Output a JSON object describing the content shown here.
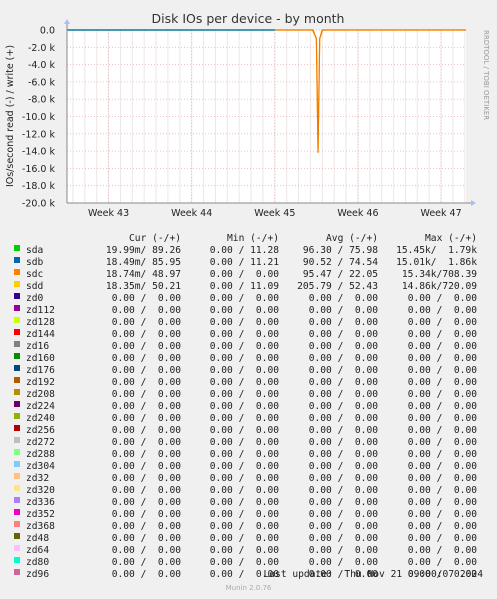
{
  "chart_data": {
    "type": "line",
    "title": "Disk IOs per device - by month",
    "ylabel": "IOs/second read (-) / write (+)",
    "ylim": [
      -20000,
      0
    ],
    "yticks": [
      0,
      -2000,
      -4000,
      -6000,
      -8000,
      -10000,
      -12000,
      -14000,
      -16000,
      -18000,
      -20000
    ],
    "ytick_labels": [
      "0.0",
      "-2.0 k",
      "-4.0 k",
      "-6.0 k",
      "-8.0 k",
      "-10.0 k",
      "-12.0 k",
      "-14.0 k",
      "-16.0 k",
      "-18.0 k",
      "-20.0 k"
    ],
    "xticks": [
      "Week 43",
      "Week 44",
      "Week 45",
      "Week 46",
      "Week 47"
    ],
    "xtick_positions": [
      43,
      44,
      45,
      46,
      47
    ],
    "xlim": [
      42.5,
      47.3
    ],
    "grid": true,
    "legend_position": "bottom",
    "series": [
      {
        "name": "sdd",
        "color": "#f6c200",
        "x": [
          45.0,
          45.45,
          45.5,
          45.52,
          45.54,
          45.58,
          47.3
        ],
        "y": [
          0,
          0,
          -1000,
          -13800,
          -1000,
          0,
          0
        ]
      },
      {
        "name": "sdc",
        "color": "#f57900",
        "x": [
          45.0,
          45.46,
          45.5,
          45.52,
          45.54,
          45.57,
          47.3
        ],
        "y": [
          0,
          0,
          -1000,
          -14200,
          -1000,
          0,
          0
        ]
      },
      {
        "name": "sda",
        "color": "#00cc00",
        "x": [
          42.5,
          45.0
        ],
        "y": [
          0,
          0
        ]
      },
      {
        "name": "sdb",
        "color": "#0066b3",
        "x": [
          42.5,
          45.0
        ],
        "y": [
          0,
          0
        ]
      }
    ]
  },
  "side_credit": "RRDTOOL / TOBI OETIKER",
  "legend": {
    "headers": {
      "cur": "Cur (-/+)",
      "min": "Min (-/+)",
      "avg": "Avg (-/+)",
      "max": "Max (-/+)"
    },
    "rows": [
      {
        "name": "sda",
        "color": "#00cc00",
        "cur": "19.99m/ 89.26",
        "min": "0.00 / 11.28",
        "avg": "96.30 / 75.98",
        "max": "15.45k/  1.79k"
      },
      {
        "name": "sdb",
        "color": "#0066b3",
        "cur": "18.49m/ 85.95",
        "min": "0.00 / 11.21",
        "avg": "90.52 / 74.54",
        "max": "15.01k/  1.86k"
      },
      {
        "name": "sdc",
        "color": "#ff8000",
        "cur": "18.74m/ 48.97",
        "min": "0.00 /  0.00",
        "avg": "95.47 / 22.05",
        "max": "15.34k/708.39"
      },
      {
        "name": "sdd",
        "color": "#ffcc00",
        "cur": "18.35m/ 50.21",
        "min": "0.00 / 11.09",
        "avg": "205.79 / 52.43",
        "max": "14.86k/720.09"
      },
      {
        "name": "zd0",
        "color": "#330099",
        "cur": "0.00 /  0.00",
        "min": "0.00 /  0.00",
        "avg": "0.00 /  0.00",
        "max": "0.00 /  0.00"
      },
      {
        "name": "zd112",
        "color": "#990099",
        "cur": "0.00 /  0.00",
        "min": "0.00 /  0.00",
        "avg": "0.00 /  0.00",
        "max": "0.00 /  0.00"
      },
      {
        "name": "zd128",
        "color": "#ccff00",
        "cur": "0.00 /  0.00",
        "min": "0.00 /  0.00",
        "avg": "0.00 /  0.00",
        "max": "0.00 /  0.00"
      },
      {
        "name": "zd144",
        "color": "#ff0000",
        "cur": "0.00 /  0.00",
        "min": "0.00 /  0.00",
        "avg": "0.00 /  0.00",
        "max": "0.00 /  0.00"
      },
      {
        "name": "zd16",
        "color": "#808080",
        "cur": "0.00 /  0.00",
        "min": "0.00 /  0.00",
        "avg": "0.00 /  0.00",
        "max": "0.00 /  0.00"
      },
      {
        "name": "zd160",
        "color": "#008f00",
        "cur": "0.00 /  0.00",
        "min": "0.00 /  0.00",
        "avg": "0.00 /  0.00",
        "max": "0.00 /  0.00"
      },
      {
        "name": "zd176",
        "color": "#00487d",
        "cur": "0.00 /  0.00",
        "min": "0.00 /  0.00",
        "avg": "0.00 /  0.00",
        "max": "0.00 /  0.00"
      },
      {
        "name": "zd192",
        "color": "#b35a00",
        "cur": "0.00 /  0.00",
        "min": "0.00 /  0.00",
        "avg": "0.00 /  0.00",
        "max": "0.00 /  0.00"
      },
      {
        "name": "zd208",
        "color": "#b38f00",
        "cur": "0.00 /  0.00",
        "min": "0.00 /  0.00",
        "avg": "0.00 /  0.00",
        "max": "0.00 /  0.00"
      },
      {
        "name": "zd224",
        "color": "#6b006b",
        "cur": "0.00 /  0.00",
        "min": "0.00 /  0.00",
        "avg": "0.00 /  0.00",
        "max": "0.00 /  0.00"
      },
      {
        "name": "zd240",
        "color": "#8fb300",
        "cur": "0.00 /  0.00",
        "min": "0.00 /  0.00",
        "avg": "0.00 /  0.00",
        "max": "0.00 /  0.00"
      },
      {
        "name": "zd256",
        "color": "#b30000",
        "cur": "0.00 /  0.00",
        "min": "0.00 /  0.00",
        "avg": "0.00 /  0.00",
        "max": "0.00 /  0.00"
      },
      {
        "name": "zd272",
        "color": "#bebebe",
        "cur": "0.00 /  0.00",
        "min": "0.00 /  0.00",
        "avg": "0.00 /  0.00",
        "max": "0.00 /  0.00"
      },
      {
        "name": "zd288",
        "color": "#80ff80",
        "cur": "0.00 /  0.00",
        "min": "0.00 /  0.00",
        "avg": "0.00 /  0.00",
        "max": "0.00 /  0.00"
      },
      {
        "name": "zd304",
        "color": "#80c9ff",
        "cur": "0.00 /  0.00",
        "min": "0.00 /  0.00",
        "avg": "0.00 /  0.00",
        "max": "0.00 /  0.00"
      },
      {
        "name": "zd32",
        "color": "#ffc080",
        "cur": "0.00 /  0.00",
        "min": "0.00 /  0.00",
        "avg": "0.00 /  0.00",
        "max": "0.00 /  0.00"
      },
      {
        "name": "zd320",
        "color": "#ffe680",
        "cur": "0.00 /  0.00",
        "min": "0.00 /  0.00",
        "avg": "0.00 /  0.00",
        "max": "0.00 /  0.00"
      },
      {
        "name": "zd336",
        "color": "#aa80ff",
        "cur": "0.00 /  0.00",
        "min": "0.00 /  0.00",
        "avg": "0.00 /  0.00",
        "max": "0.00 /  0.00"
      },
      {
        "name": "zd352",
        "color": "#ee00cc",
        "cur": "0.00 /  0.00",
        "min": "0.00 /  0.00",
        "avg": "0.00 /  0.00",
        "max": "0.00 /  0.00"
      },
      {
        "name": "zd368",
        "color": "#ff8080",
        "cur": "0.00 /  0.00",
        "min": "0.00 /  0.00",
        "avg": "0.00 /  0.00",
        "max": "0.00 /  0.00"
      },
      {
        "name": "zd48",
        "color": "#666600",
        "cur": "0.00 /  0.00",
        "min": "0.00 /  0.00",
        "avg": "0.00 /  0.00",
        "max": "0.00 /  0.00"
      },
      {
        "name": "zd64",
        "color": "#ffbfff",
        "cur": "0.00 /  0.00",
        "min": "0.00 /  0.00",
        "avg": "0.00 /  0.00",
        "max": "0.00 /  0.00"
      },
      {
        "name": "zd80",
        "color": "#00ffcc",
        "cur": "0.00 /  0.00",
        "min": "0.00 /  0.00",
        "avg": "0.00 /  0.00",
        "max": "0.00 /  0.00"
      },
      {
        "name": "zd96",
        "color": "#cc6699",
        "cur": "0.00 /  0.00",
        "min": "0.00 /  0.00",
        "avg": "0.00 /  0.00",
        "max": "0.00 /  0.00"
      }
    ]
  },
  "last_update": "Last update:  Thu Nov 21 09:00:07 2024",
  "version": "Munin 2.0.76"
}
